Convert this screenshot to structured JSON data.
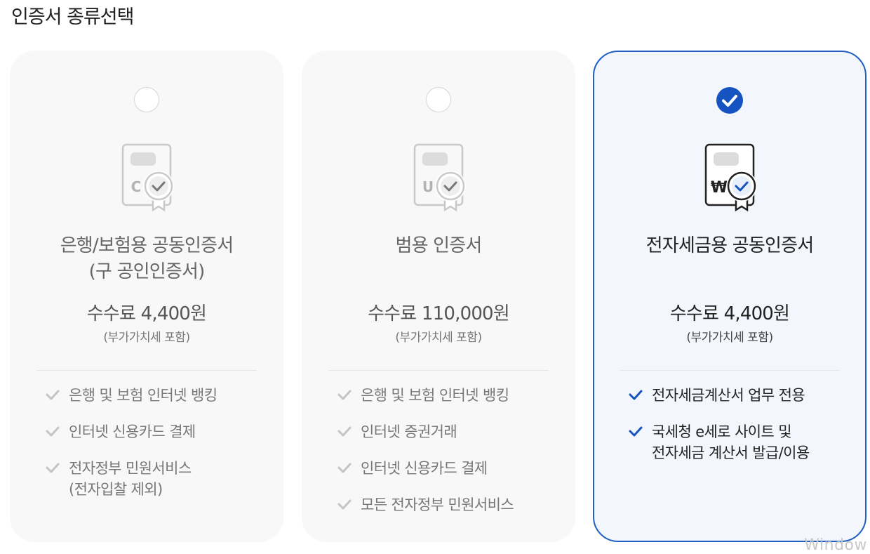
{
  "page_title": "인증서 종류선택",
  "cards": [
    {
      "selected": false,
      "icon_letter": "C",
      "title_line1": "은행/보험용 공동인증서",
      "title_line2": "(구 공인인증서)",
      "fee": "수수료 4,400원",
      "vat": "(부가가치세 포함)",
      "features": [
        "은행 및 보험 인터넷 뱅킹",
        "인터넷 신용카드 결제",
        "전자정부 민원서비스"
      ],
      "feature3_sub": "(전자입찰 제외)"
    },
    {
      "selected": false,
      "icon_letter": "U",
      "title_line1": "범용 인증서",
      "fee": "수수료 110,000원",
      "vat": "(부가가치세 포함)",
      "features": [
        "은행 및 보험 인터넷 뱅킹",
        "인터넷 증권거래",
        "인터넷 신용카드 결제",
        "모든 전자정부 민원서비스"
      ]
    },
    {
      "selected": true,
      "icon_letter": "₩",
      "title_line1": "전자세금용 공동인증서",
      "fee": "수수료 4,400원",
      "vat": "(부가가치세 포함)",
      "features": [
        "전자세금계산서 업무 전용",
        "국세청 e세로 사이트 및"
      ],
      "feature2_sub": "전자세금 계산서 발급/이용"
    }
  ],
  "colors": {
    "accent": "#1554c0",
    "selected_border": "#1f5fc4",
    "selected_bg": "#f3f7fd",
    "card_bg": "#f8f8f8",
    "muted_check": "#c4c4c4"
  },
  "icons": {
    "unselected_radio": "empty-circle",
    "selected_radio": "blue-check-circle",
    "certificate": "certificate-with-seal-icon",
    "feature_bullet": "check-icon"
  },
  "watermark": "Window"
}
